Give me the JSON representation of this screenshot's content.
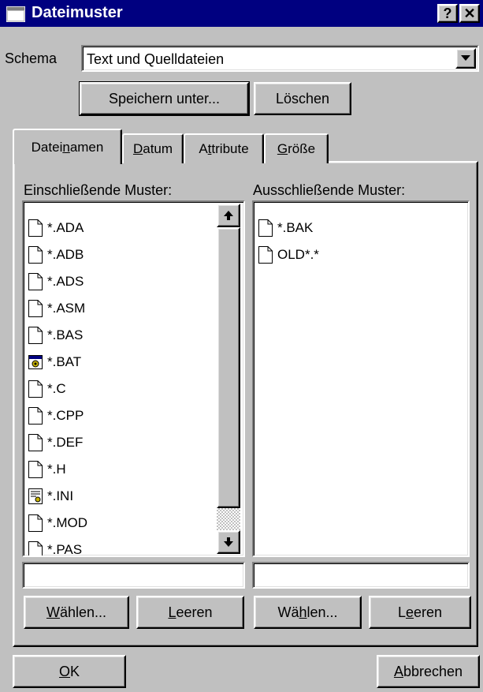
{
  "window": {
    "title": "Dateimuster",
    "help_label": "?",
    "close_label": "✕"
  },
  "schema": {
    "label": "Schema",
    "value": "Text und Quelldateien",
    "save_as_label": "Speichern unter...",
    "delete_label": "Löschen"
  },
  "tabs": [
    {
      "pre": "Datei",
      "key": "n",
      "post": "amen"
    },
    {
      "pre": "",
      "key": "D",
      "post": "atum"
    },
    {
      "pre": "A",
      "key": "t",
      "post": "tribute"
    },
    {
      "pre": "",
      "key": "G",
      "post": "röße"
    }
  ],
  "include": {
    "label": "Einschließende Muster:",
    "items": [
      {
        "text": "*.ADA",
        "icon": "document-icon"
      },
      {
        "text": "*.ADB",
        "icon": "document-icon"
      },
      {
        "text": "*.ADS",
        "icon": "document-icon"
      },
      {
        "text": "*.ASM",
        "icon": "document-icon"
      },
      {
        "text": "*.BAS",
        "icon": "document-icon"
      },
      {
        "text": "*.BAT",
        "icon": "batch-file-icon"
      },
      {
        "text": "*.C",
        "icon": "document-icon"
      },
      {
        "text": "*.CPP",
        "icon": "document-icon"
      },
      {
        "text": "*.DEF",
        "icon": "document-icon"
      },
      {
        "text": "*.H",
        "icon": "document-icon"
      },
      {
        "text": "*.INI",
        "icon": "settings-file-icon"
      },
      {
        "text": "*.MOD",
        "icon": "document-icon"
      },
      {
        "text": "*.PAS",
        "icon": "document-icon"
      }
    ],
    "input_value": "",
    "select_pre": "",
    "select_key": "W",
    "select_post": "ählen...",
    "clear_pre": "",
    "clear_key": "L",
    "clear_post": "eeren"
  },
  "exclude": {
    "label": "Ausschließende Muster:",
    "items": [
      {
        "text": "*.BAK",
        "icon": "document-icon"
      },
      {
        "text": "OLD*.*",
        "icon": "document-icon"
      }
    ],
    "input_value": "",
    "select_pre": "Wä",
    "select_key": "h",
    "select_post": "len...",
    "clear_pre": "L",
    "clear_key": "e",
    "clear_post": "eren"
  },
  "footer": {
    "ok_pre": "",
    "ok_key": "O",
    "ok_post": "K",
    "cancel_pre": "",
    "cancel_key": "A",
    "cancel_post": "bbrechen"
  },
  "colors": {
    "titlebar": "#000080",
    "face": "#c0c0c0",
    "shadow": "#808080"
  }
}
